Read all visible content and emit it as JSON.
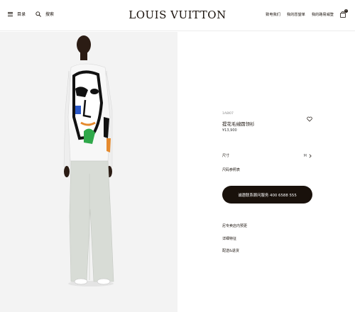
{
  "header": {
    "menu_label": "目录",
    "search_label": "搜索",
    "logo": "LOUIS VUITTON",
    "links": [
      "致电我们",
      "我的愿望单",
      "我的路易威登"
    ],
    "cart_count": "0"
  },
  "product": {
    "sku": "1A8I07",
    "name": "提花毛绒圆领衫",
    "price": "¥13,900",
    "size_label": "尺寸",
    "size_value": "M",
    "size_guide": "尺码参照表",
    "cta": "诚邀联系顾问服务 400 6588 555",
    "links": [
      "尼专卖店内预更",
      "详细特征",
      "配送&退货"
    ]
  },
  "colors": {
    "brand_dark": "#19110b",
    "image_background": "#f3f3f3"
  },
  "icons": [
    "menu-icon",
    "search-icon",
    "shopping-bag-icon",
    "heart-icon",
    "chevron-right-icon"
  ]
}
